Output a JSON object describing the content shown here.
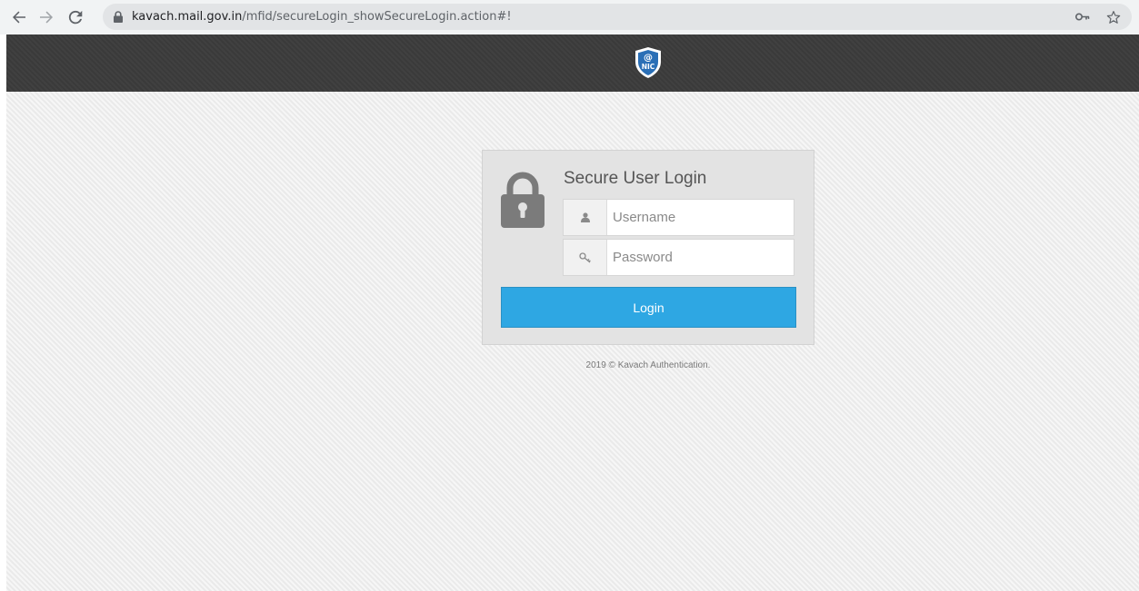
{
  "browser": {
    "url_host": "kavach.mail.gov.in",
    "url_path": "/mfid/secureLogin_showSecureLogin.action#!",
    "icons": {
      "back": "back-arrow-icon",
      "forward": "forward-arrow-icon",
      "reload": "reload-icon",
      "lock": "lock-icon",
      "key": "key-icon",
      "star": "star-icon"
    }
  },
  "header": {
    "logo": "nic-logo"
  },
  "login": {
    "title": "Secure User Login",
    "username_placeholder": "Username",
    "password_placeholder": "Password",
    "button_label": "Login",
    "icons": {
      "lock": "padlock-icon",
      "user": "user-icon",
      "password": "key-icon"
    },
    "colors": {
      "button": "#2ea7e3"
    }
  },
  "footer": {
    "text": "2019 © Kavach Authentication."
  }
}
